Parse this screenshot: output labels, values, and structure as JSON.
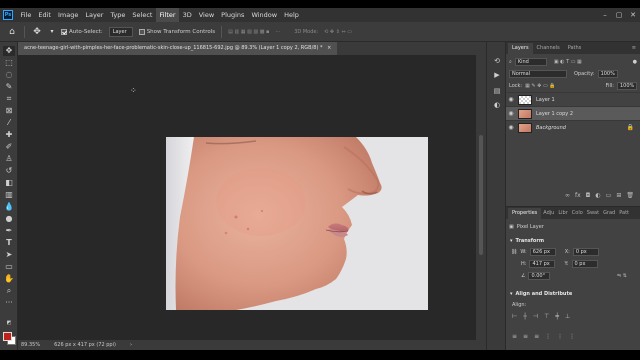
{
  "menu": {
    "logo": "Ps",
    "items": [
      "File",
      "Edit",
      "Image",
      "Layer",
      "Type",
      "Select",
      "Filter",
      "3D",
      "View",
      "Plugins",
      "Window",
      "Help"
    ],
    "active_item": "Filter"
  },
  "options_bar": {
    "auto_select_label": "Auto-Select:",
    "auto_select_value": "Layer",
    "show_transform_label": "Show Transform Controls",
    "mode_3d": "3D Mode:"
  },
  "document_tab": {
    "title": "acne-teenage-girl-with-pimples-her-face-problematic-skin-close-up_116815-692.jpg @ 89.3% (Layer 1 copy 2, RGB/8) *"
  },
  "status_bar": {
    "zoom": "89.35%",
    "dimensions": "626 px x 417 px (72 ppi)"
  },
  "layers_panel": {
    "tabs": [
      "Layers",
      "Channels",
      "Paths"
    ],
    "active_tab": "Layers",
    "kind_label": "Kind",
    "blend_mode": "Normal",
    "opacity_label": "Opacity:",
    "opacity_value": "100%",
    "lock_label": "Lock:",
    "fill_label": "Fill:",
    "fill_value": "100%",
    "layers": [
      {
        "name": "Layer 1",
        "thumb": "checker",
        "selected": false,
        "italic": false,
        "locked": false
      },
      {
        "name": "Layer 1 copy 2",
        "thumb": "face",
        "selected": true,
        "italic": false,
        "locked": false
      },
      {
        "name": "Background",
        "thumb": "face",
        "selected": false,
        "italic": true,
        "locked": true
      }
    ]
  },
  "properties_panel": {
    "tabs": [
      "Properties",
      "Adju",
      "Libr",
      "Colo",
      "Swat",
      "Grad",
      "Patt"
    ],
    "active_tab": "Properties",
    "pixel_layer_label": "Pixel Layer",
    "transform_heading": "Transform",
    "w_label": "W:",
    "w_value": "626 px",
    "h_label": "H:",
    "h_value": "417 px",
    "x_label": "X:",
    "x_value": "0 px",
    "y_label": "Y:",
    "y_value": "0 px",
    "angle_value": "0.00°",
    "align_heading": "Align and Distribute",
    "align_label": "Align:"
  }
}
